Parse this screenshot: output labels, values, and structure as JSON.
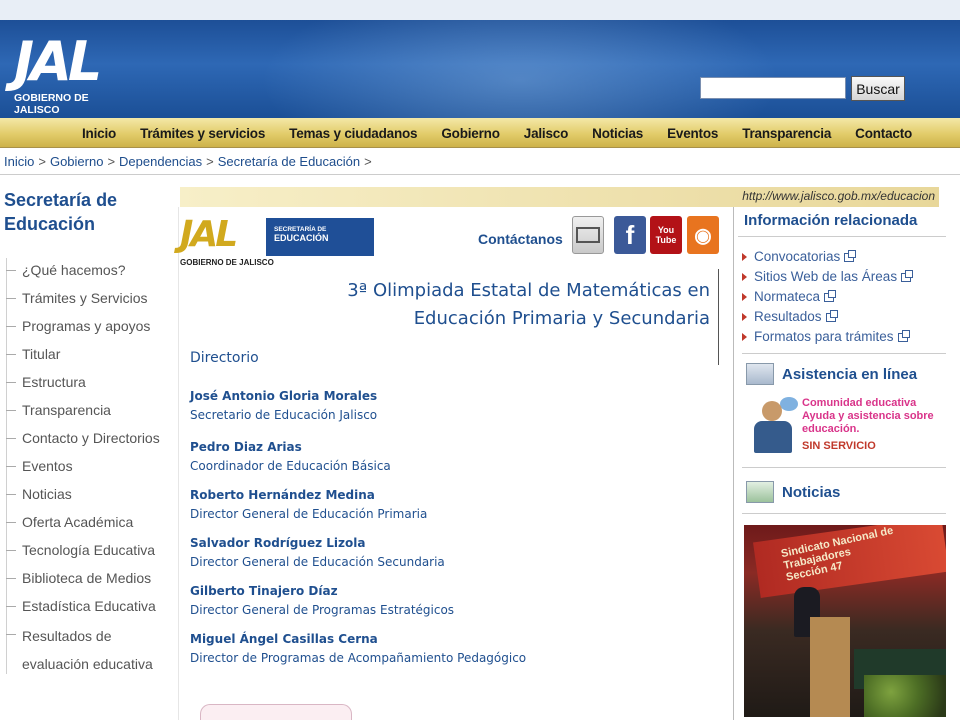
{
  "header": {
    "logo_main": "JAL",
    "logo_sub": "GOBIERNO DE JALISCO",
    "search_button": "Buscar",
    "search_value": ""
  },
  "nav": {
    "items": [
      "Inicio",
      "Trámites y servicios",
      "Temas y ciudadanos",
      "Gobierno",
      "Jalisco",
      "Noticias",
      "Eventos",
      "Transparencia",
      "Contacto"
    ]
  },
  "breadcrumb": {
    "items": [
      "Inicio",
      "Gobierno",
      "Dependencias",
      "Secretaría de Educación"
    ],
    "separator": ">"
  },
  "sidebar": {
    "title_line1": "Secretaría de",
    "title_line2": "Educación",
    "items": [
      "¿Qué hacemos?",
      "Trámites y Servicios",
      "Programas y apoyos",
      "Titular",
      "Estructura",
      "Transparencia",
      "Contacto y Directorios",
      "Eventos",
      "Noticias",
      "Oferta Académica",
      "Tecnología Educativa",
      "Biblioteca de Medios",
      "Estadística Educativa",
      "Resultados de evaluación educativa"
    ]
  },
  "urlbar": {
    "url": "http://www.jalisco.gob.mx/educacion"
  },
  "badge": {
    "jal": "JAL",
    "gobierno": "GOBIERNO DE JALISCO",
    "secretaria": "SECRETARÍA DE",
    "educacion": "EDUCACIÓN"
  },
  "contact": {
    "label": "Contáctanos",
    "icons": [
      "mail-icon",
      "facebook-icon",
      "youtube-icon",
      "rss-icon"
    ],
    "fb_glyph": "f",
    "yt_line1": "You",
    "yt_line2": "Tube",
    "rss_glyph": "◉"
  },
  "main": {
    "title_line1": "3ª Olimpiada Estatal de Matemáticas en",
    "title_line2": "Educación Primaria y Secundaria",
    "directory_title": "Directorio",
    "people": [
      {
        "name": "José Antonio Gloria Morales",
        "role": "Secretario de Educación Jalisco"
      },
      {
        "name": "Pedro Diaz Arias",
        "role": "Coordinador de Educación Básica"
      },
      {
        "name": "Roberto Hernández Medina",
        "role": "Director General de Educación Primaria"
      },
      {
        "name": "Salvador Rodríguez Lizola",
        "role": "Director General de Educación Secundaria"
      },
      {
        "name": "Gilberto Tinajero Díaz",
        "role": "Director General de Programas Estratégicos"
      },
      {
        "name": "Miguel Ángel Casillas Cerna",
        "role": "Director de Programas de Acompañamiento Pedagógico"
      }
    ]
  },
  "right": {
    "title": "Información relacionada",
    "links": [
      "Convocatorias",
      "Sitios Web de las Áreas",
      "Normateca",
      "Resultados",
      "Formatos para trámites"
    ],
    "assist_title": "Asistencia en línea",
    "assist_line1": "Comunidad educativa",
    "assist_line2": "Ayuda y asistencia sobre educación.",
    "assist_status": "SIN SERVICIO",
    "news_title": "Noticias",
    "photo_banner_line1": "Sindicato Nacional de Trabajadores",
    "photo_banner_line2": "Sección 47"
  },
  "colors": {
    "header_blue": "#1d4f97",
    "nav_gold": "#e2cc6a",
    "link_blue": "#1f4f8f",
    "assist_pink": "#d9348a"
  }
}
